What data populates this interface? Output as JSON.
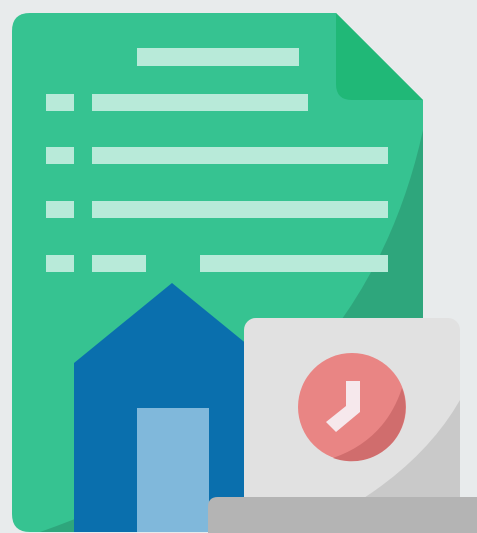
{
  "illustration": {
    "subject": "document-home-laptop-clock-icon",
    "colors": {
      "background": "#e8ebec",
      "document": "#36c391",
      "document_shadow": "#2ea67c",
      "document_fold": "#20b877",
      "document_lines": "#b8ead9",
      "house": "#0a6fad",
      "house_door": "#80b8db",
      "laptop_screen": "#e1e1e1",
      "laptop_shadow": "#c9c9c9",
      "laptop_base": "#b4b4b4",
      "clock_face": "#e98584",
      "clock_shadow": "#d06d6d",
      "clock_hand": "#f6e8ec"
    }
  }
}
